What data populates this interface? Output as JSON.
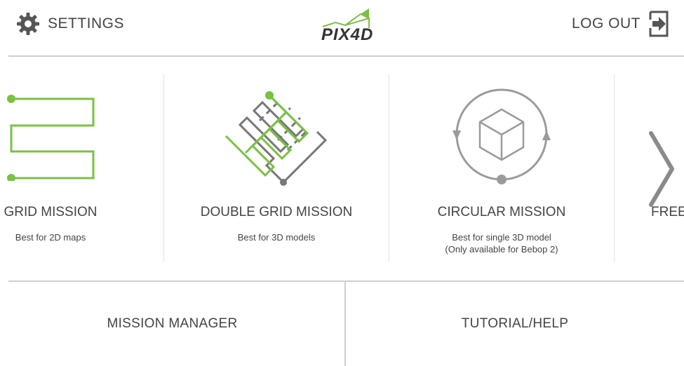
{
  "header": {
    "settings_label": "SETTINGS",
    "logo_text": "PIX4D",
    "logout_label": "LOG OUT"
  },
  "missions": [
    {
      "title": "GRID MISSION",
      "desc_lines": [
        "Best for 2D maps"
      ],
      "icon": "grid-mission-icon"
    },
    {
      "title": "DOUBLE GRID MISSION",
      "desc_lines": [
        "Best for 3D models"
      ],
      "icon": "double-grid-mission-icon"
    },
    {
      "title": "CIRCULAR MISSION",
      "desc_lines": [
        "Best for single 3D model",
        "(Only available for Bebop 2)"
      ],
      "icon": "circular-mission-icon"
    },
    {
      "title": "FREE",
      "desc_lines": [],
      "icon": "free-flight-icon"
    }
  ],
  "carousel": {
    "next_icon": "chevron-right-icon"
  },
  "bottom": {
    "mission_manager_label": "MISSION MANAGER",
    "tutorial_help_label": "TUTORIAL/HELP"
  },
  "colors": {
    "accent_green": "#7ac143",
    "icon_gray": "#9b9b9b",
    "text": "#444444",
    "divider": "#cfcfcf"
  }
}
